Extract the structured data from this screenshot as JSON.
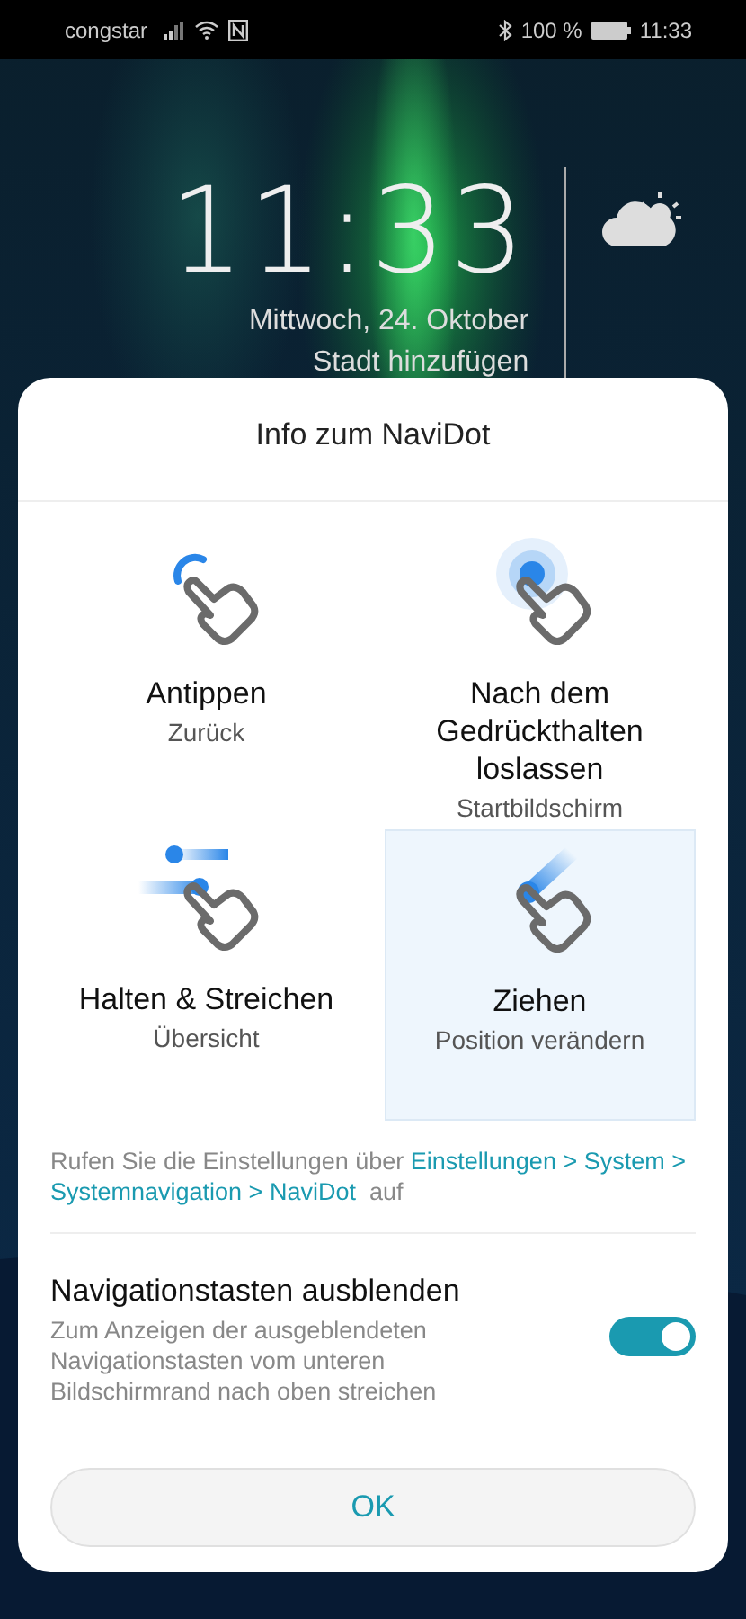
{
  "status_bar": {
    "carrier": "congstar",
    "battery": "100 %",
    "time": "11:33"
  },
  "lock_screen": {
    "time": "11:33",
    "date": "Mittwoch, 24. Oktober",
    "city": "Stadt hinzufügen"
  },
  "dialog": {
    "title": "Info zum NaviDot",
    "gestures": [
      {
        "kind": "tap",
        "title": "Antippen",
        "subtitle": "Zurück",
        "selected": false
      },
      {
        "kind": "press",
        "title": "Nach dem Gedrückthalten loslassen",
        "subtitle": "Startbildschirm",
        "selected": false
      },
      {
        "kind": "swipe",
        "title": "Halten & Streichen",
        "subtitle": "Übersicht",
        "selected": false
      },
      {
        "kind": "drag",
        "title": "Ziehen",
        "subtitle": "Position verändern",
        "selected": true
      }
    ],
    "hint": [
      {
        "kind": "plain",
        "text": "Rufen Sie die Einstellungen über "
      },
      {
        "kind": "link",
        "text": "Einstellungen > System >"
      },
      {
        "kind": "link",
        "text": "Systemnavigation > NaviDot"
      },
      {
        "kind": "plain",
        "text": " auf"
      }
    ],
    "setting": {
      "title": "Navigationstasten ausblenden",
      "description": "Zum Anzeigen der ausgeblendeten Navigationstasten vom unteren Bildschirmrand nach oben streichen",
      "on": true
    },
    "button": "OK"
  }
}
